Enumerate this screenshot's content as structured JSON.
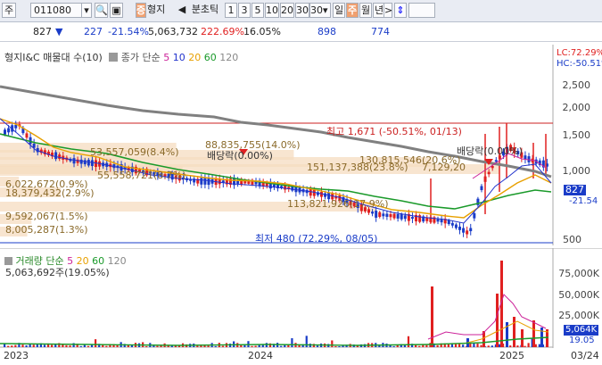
{
  "toolbar": {
    "market": "주",
    "code": "011080",
    "name_tag": "형지",
    "name_tag_prefix": "증",
    "period_left": "◀",
    "period_label": "분초틱",
    "periods": [
      "1",
      "3",
      "5",
      "10",
      "20",
      "30"
    ],
    "period_dropdown": "30",
    "day": "일",
    "week": "주",
    "month": "월",
    "year": "년",
    "nav_right": ">",
    "updown": "⇕"
  },
  "quote": {
    "price": "827",
    "arrow": "▼",
    "change": "227",
    "change_pct": "-21.54%",
    "volume": "5,063,732",
    "vol_ratio": "222.69%",
    "turnover": "16.05%",
    "v1": "898",
    "v2": "774"
  },
  "price_panel": {
    "legend_title": "형지I&C 매물대 수(10)",
    "legend_ma_label": "종가 단순",
    "legend_ma": [
      "5",
      "10",
      "20",
      "60",
      "120"
    ],
    "lc_label": "LC:72.29%",
    "hc_label": "HC:-50.51%",
    "high_label": "최고 1,671 (-50.51%, 01/13)",
    "low_label": "최저 480 (72.29%, 08/05)",
    "dividend_labels": [
      "배당락(0.00%)",
      "배당락(0.00%)"
    ],
    "volume_profile": [
      "53,557,059(8.4%)",
      "88,835,755(14.0%)",
      "55,558,721(8.7%)",
      "130,815,546(20.6%)",
      "151,137,388(23.8%)",
      "7,129,20",
      "6,022,672(0.9%)",
      "18,379,432(2.9%)",
      "113,821,926(17.9%)",
      "9,592,067(1.5%)",
      "8,005,287(1.3%)"
    ],
    "y_ticks": [
      "2,500",
      "2,000",
      "1,500",
      "1,000",
      "500"
    ],
    "current_tag": "827",
    "current_pct": "-21.54"
  },
  "volume_panel": {
    "legend_title": "거래량 단순",
    "legend_ma": [
      "5",
      "20",
      "60",
      "120"
    ],
    "volume_text": "5,063,692주(19.05%)",
    "y_ticks": [
      "75,000K",
      "50,000K",
      "25,000K"
    ],
    "current_tag": "5,064K",
    "current_pct": "19.05"
  },
  "x_axis": [
    "2023",
    "2024",
    "2025",
    "03/24"
  ],
  "chart_data": {
    "type": "line",
    "title": "형지I&C 매물대 수(10)",
    "series": [
      {
        "name": "종가 단순 120",
        "color": "#808080"
      },
      {
        "name": "종가 단순 60",
        "color": "#1a9a2a"
      },
      {
        "name": "종가 단순 20",
        "color": "#e8a000"
      },
      {
        "name": "종가 단순 10",
        "color": "#2233cc"
      },
      {
        "name": "종가 단순 5",
        "color": "#cc2299"
      }
    ],
    "high": {
      "value": 1671,
      "date": "01/13"
    },
    "low": {
      "value": 480,
      "date": "08/05"
    },
    "last_close": 827,
    "y_ticks": [
      2500,
      2000,
      1500,
      1000,
      500
    ],
    "volume_profile_pct": [
      8.4,
      14.0,
      8.7,
      20.6,
      23.8,
      0.9,
      2.9,
      17.9,
      1.5,
      1.3
    ]
  },
  "colors": {
    "up": "#e02020",
    "down": "#1a3cc8",
    "ma120": "#808080",
    "ma60": "#1a9a2a",
    "ma20": "#e8a000",
    "ma10": "#2233cc",
    "ma5": "#cc2299",
    "profile": "#f5dcc0",
    "high_line": "#cc2222"
  }
}
